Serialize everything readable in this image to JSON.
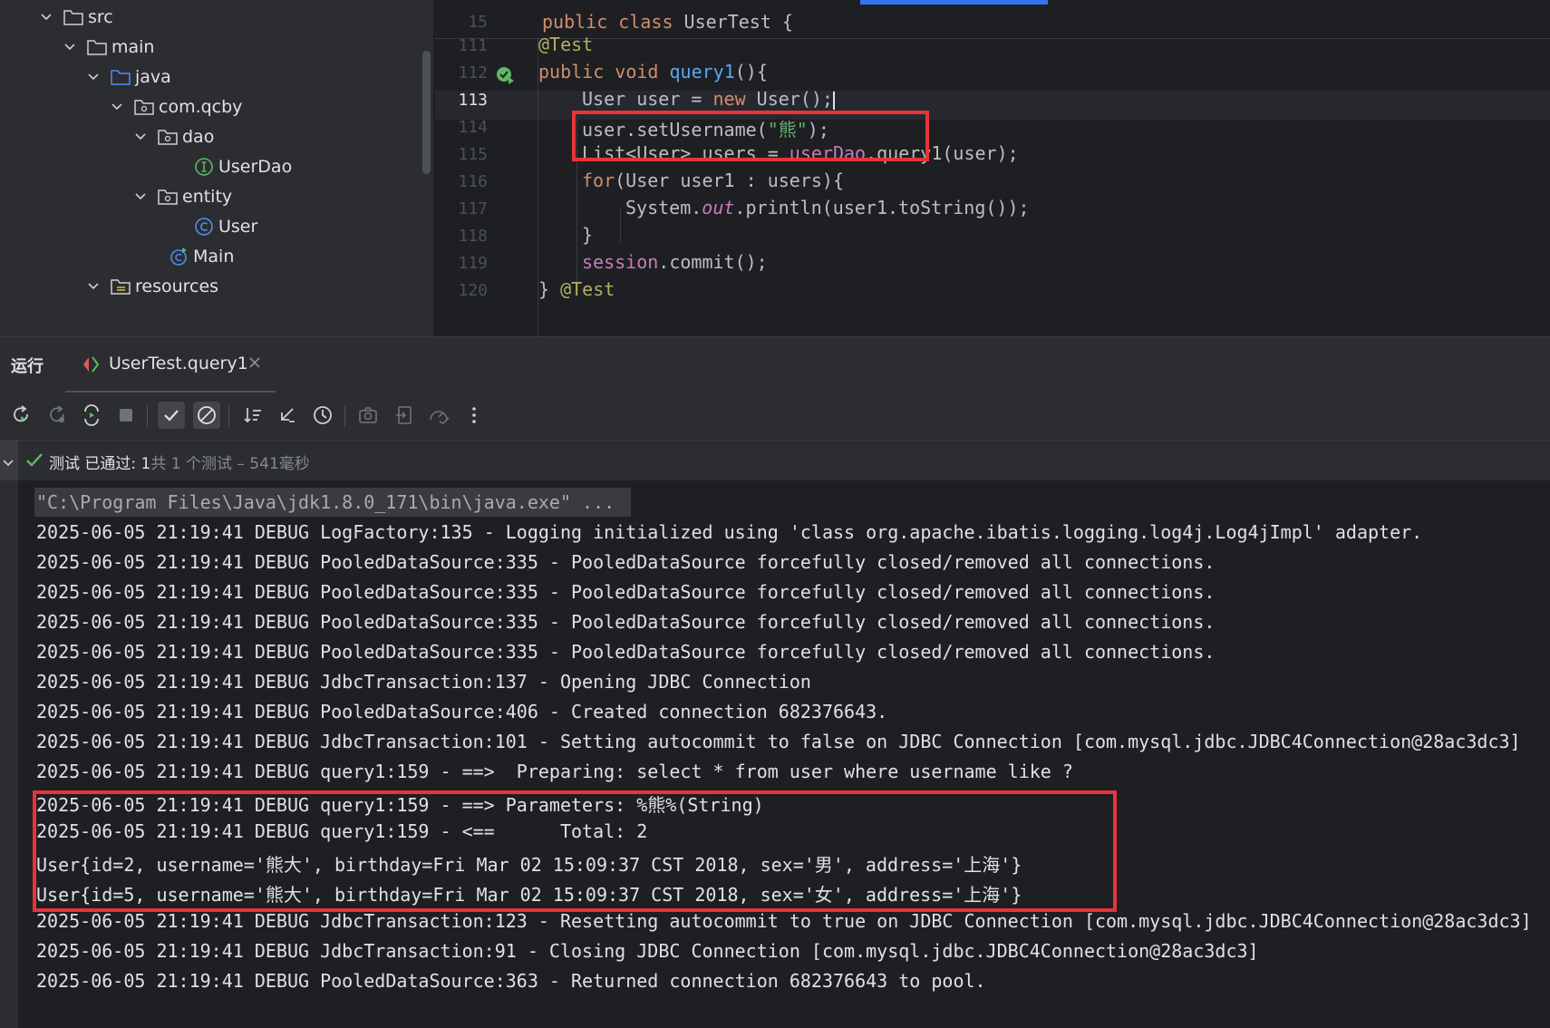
{
  "tree": {
    "items": [
      {
        "label": "src",
        "icon": "folder-icon"
      },
      {
        "label": "main",
        "icon": "folder-icon"
      },
      {
        "label": "java",
        "icon": "source-folder-icon"
      },
      {
        "label": "com.qcby",
        "icon": "package-icon"
      },
      {
        "label": "dao",
        "icon": "package-icon"
      },
      {
        "label": "UserDao",
        "icon": "interface-icon"
      },
      {
        "label": "entity",
        "icon": "package-icon"
      },
      {
        "label": "User",
        "icon": "class-icon"
      },
      {
        "label": "Main",
        "icon": "main-class-icon"
      },
      {
        "label": "resources",
        "icon": "resources-folder-icon"
      }
    ]
  },
  "editor": {
    "sticky_line_number": "15",
    "line_numbers": [
      "111",
      "112",
      "113",
      "114",
      "115",
      "116",
      "117",
      "118",
      "119",
      "120"
    ],
    "current_line": "113",
    "sticky": {
      "kw1": "public",
      "kw2": "class",
      "name": " UserTest {"
    },
    "lines": {
      "l111": {
        "ann": "@Test"
      },
      "l112": {
        "kw1": "public",
        "kw2": "void",
        "fn": "query1",
        "rest": "(){"
      },
      "l113": {
        "a": "User user = ",
        "kw": "new",
        "b": " User();"
      },
      "l114": {
        "a": "user.setUsername(",
        "str": "\"熊\"",
        "b": ");"
      },
      "l115": {
        "a": "List<User> users = ",
        "fld": "userDao",
        "b": ".query1(user);"
      },
      "l116": {
        "kw": "for",
        "a": "(User user1 : users){"
      },
      "l117": {
        "a": "System.",
        "st": "out",
        "b": ".println(user1.toString());"
      },
      "l118": {
        "a": "}"
      },
      "l119": {
        "fld": "session",
        "a": ".commit();"
      },
      "l120": {
        "a": "} ",
        "ann": "@Test"
      }
    }
  },
  "run": {
    "title": "运行",
    "tab_label": "UserTest.query1",
    "summary": {
      "status": "测试 已通过:",
      "passed": "1",
      "detail": "共 1 个测试 – 541毫秒"
    }
  },
  "colors": {
    "highlight_box": "#e8333b",
    "accent": "#3574f0",
    "pass_green": "#5fb865"
  },
  "console": [
    "\"C:\\Program Files\\Java\\jdk1.8.0_171\\bin\\java.exe\" ...",
    "2025-06-05 21:19:41 DEBUG LogFactory:135 - Logging initialized using 'class org.apache.ibatis.logging.log4j.Log4jImpl' adapter.",
    "2025-06-05 21:19:41 DEBUG PooledDataSource:335 - PooledDataSource forcefully closed/removed all connections.",
    "2025-06-05 21:19:41 DEBUG PooledDataSource:335 - PooledDataSource forcefully closed/removed all connections.",
    "2025-06-05 21:19:41 DEBUG PooledDataSource:335 - PooledDataSource forcefully closed/removed all connections.",
    "2025-06-05 21:19:41 DEBUG PooledDataSource:335 - PooledDataSource forcefully closed/removed all connections.",
    "2025-06-05 21:19:41 DEBUG JdbcTransaction:137 - Opening JDBC Connection",
    "2025-06-05 21:19:41 DEBUG PooledDataSource:406 - Created connection 682376643.",
    "2025-06-05 21:19:41 DEBUG JdbcTransaction:101 - Setting autocommit to false on JDBC Connection [com.mysql.jdbc.JDBC4Connection@28ac3dc3]",
    "2025-06-05 21:19:41 DEBUG query1:159 - ==>  Preparing: select * from user where username like ?",
    "2025-06-05 21:19:41 DEBUG query1:159 - ==> Parameters: %熊%(String)",
    "2025-06-05 21:19:41 DEBUG query1:159 - <==      Total: 2",
    "User{id=2, username='熊大', birthday=Fri Mar 02 15:09:37 CST 2018, sex='男', address='上海'}",
    "User{id=5, username='熊大', birthday=Fri Mar 02 15:09:37 CST 2018, sex='女', address='上海'}",
    "2025-06-05 21:19:41 DEBUG JdbcTransaction:123 - Resetting autocommit to true on JDBC Connection [com.mysql.jdbc.JDBC4Connection@28ac3dc3]",
    "2025-06-05 21:19:41 DEBUG JdbcTransaction:91 - Closing JDBC Connection [com.mysql.jdbc.JDBC4Connection@28ac3dc3]",
    "2025-06-05 21:19:41 DEBUG PooledDataSource:363 - Returned connection 682376643 to pool."
  ]
}
